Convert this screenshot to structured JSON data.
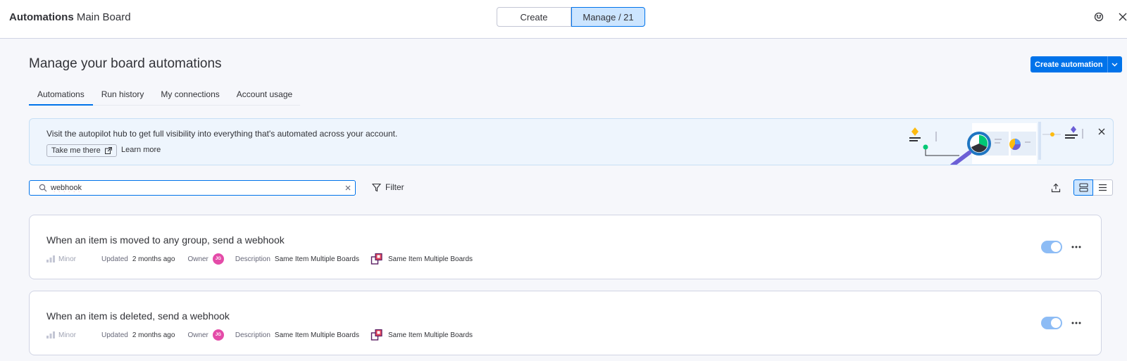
{
  "header": {
    "title_bold": "Automations",
    "title_rest": "Main Board",
    "segments": {
      "create": "Create",
      "manage": "Manage / 21"
    },
    "icons": {
      "feedback": "feedback-icon",
      "close": "close-icon"
    }
  },
  "page": {
    "title": "Manage your board automations",
    "create_button": "Create automation"
  },
  "tabs": [
    {
      "label": "Automations",
      "active": true
    },
    {
      "label": "Run history",
      "active": false
    },
    {
      "label": "My connections",
      "active": false
    },
    {
      "label": "Account usage",
      "active": false
    }
  ],
  "banner": {
    "text": "Visit the autopilot hub to get full visibility into everything that's automated across your account.",
    "take_me_there": "Take me there",
    "learn_more": "Learn more"
  },
  "toolbar": {
    "search_value": "webhook",
    "filter_label": "Filter"
  },
  "automations": [
    {
      "title": "When an item is moved to any group, send a webhook",
      "priority": "Minor",
      "updated_label": "Updated",
      "updated_value": "2 months ago",
      "owner_label": "Owner",
      "owner_initials": "JG",
      "description_label": "Description",
      "description_value": "Same Item Multiple Boards",
      "board_name": "Same Item Multiple Boards",
      "enabled": true
    },
    {
      "title": "When an item is deleted, send a webhook",
      "priority": "Minor",
      "updated_label": "Updated",
      "updated_value": "2 months ago",
      "owner_label": "Owner",
      "owner_initials": "JG",
      "description_label": "Description",
      "description_value": "Same Item Multiple Boards",
      "board_name": "Same Item Multiple Boards",
      "enabled": true
    }
  ],
  "colors": {
    "primary": "#0073ea",
    "selected_bg": "#cce5ff",
    "avatar": "#e44ba8",
    "toggle_on": "#8dbcf5",
    "banner_bg": "#eef5fd"
  }
}
